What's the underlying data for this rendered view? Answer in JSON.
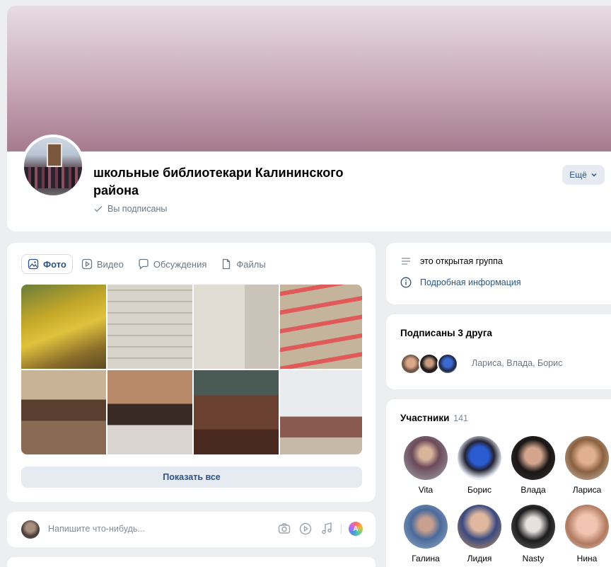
{
  "group": {
    "title": "школьные библиотекари Калининского района",
    "subscribed_label": "Вы подписаны",
    "more_label": "Ещё"
  },
  "media": {
    "tabs": [
      {
        "label": "Фото",
        "icon": "photo-icon",
        "active": true
      },
      {
        "label": "Видео",
        "icon": "video-icon",
        "active": false
      },
      {
        "label": "Обсуждения",
        "icon": "discussion-icon",
        "active": false
      },
      {
        "label": "Файлы",
        "icon": "file-icon",
        "active": false
      }
    ],
    "show_all_label": "Показать все"
  },
  "post": {
    "placeholder": "Напишите что-нибудь..."
  },
  "info": {
    "open_group": "это открытая группа",
    "details_link": "Подробная информация"
  },
  "friends": {
    "title": "Подписаны 3 друга",
    "names": "Лариса, Влада, Борис"
  },
  "members": {
    "title": "Участники",
    "count": "141",
    "items": [
      {
        "name": "Vita"
      },
      {
        "name": "Борис"
      },
      {
        "name": "Влада"
      },
      {
        "name": "Лариса"
      },
      {
        "name": "Галина"
      },
      {
        "name": "Лидия"
      },
      {
        "name": "Nasty"
      },
      {
        "name": "Нина"
      }
    ]
  },
  "colors": {
    "accent": "#2c5182",
    "link": "#2a5885",
    "muted": "#6d7885",
    "background": "#edeef0"
  }
}
